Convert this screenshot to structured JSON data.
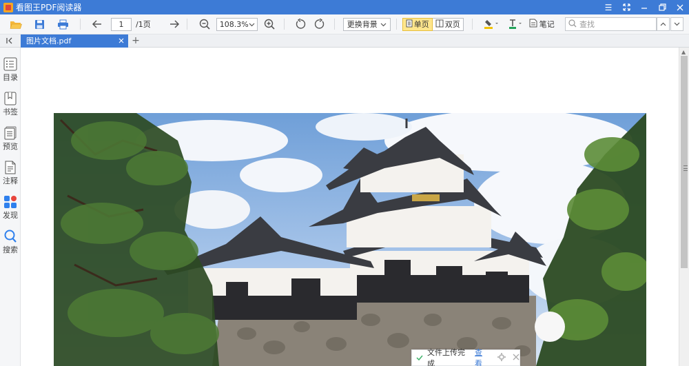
{
  "app": {
    "title": "看图王PDF阅读器"
  },
  "toolbar": {
    "page_current": "1",
    "page_total": "/1页",
    "zoom": "108.3%",
    "background_btn": "更换背景",
    "single_page": "单页",
    "double_page": "双页",
    "notes": "笔记",
    "search_placeholder": "查找"
  },
  "tabs": [
    {
      "label": "图片文档.pdf"
    }
  ],
  "sidebar": {
    "items": [
      {
        "label": "目录",
        "icon": "list-icon"
      },
      {
        "label": "书签",
        "icon": "bookmark-icon"
      },
      {
        "label": "预览",
        "icon": "preview-icon"
      },
      {
        "label": "注释",
        "icon": "annotation-icon"
      },
      {
        "label": "发现",
        "icon": "discover-icon"
      },
      {
        "label": "搜索",
        "icon": "search-icon"
      }
    ]
  },
  "toast": {
    "message": "文件上传完成",
    "link": "查看"
  },
  "colors": {
    "accent": "#3d7bd6",
    "active_mode": "#ffe68c",
    "discover_blue": "#2f80ed",
    "discover_red": "#e8453c"
  }
}
